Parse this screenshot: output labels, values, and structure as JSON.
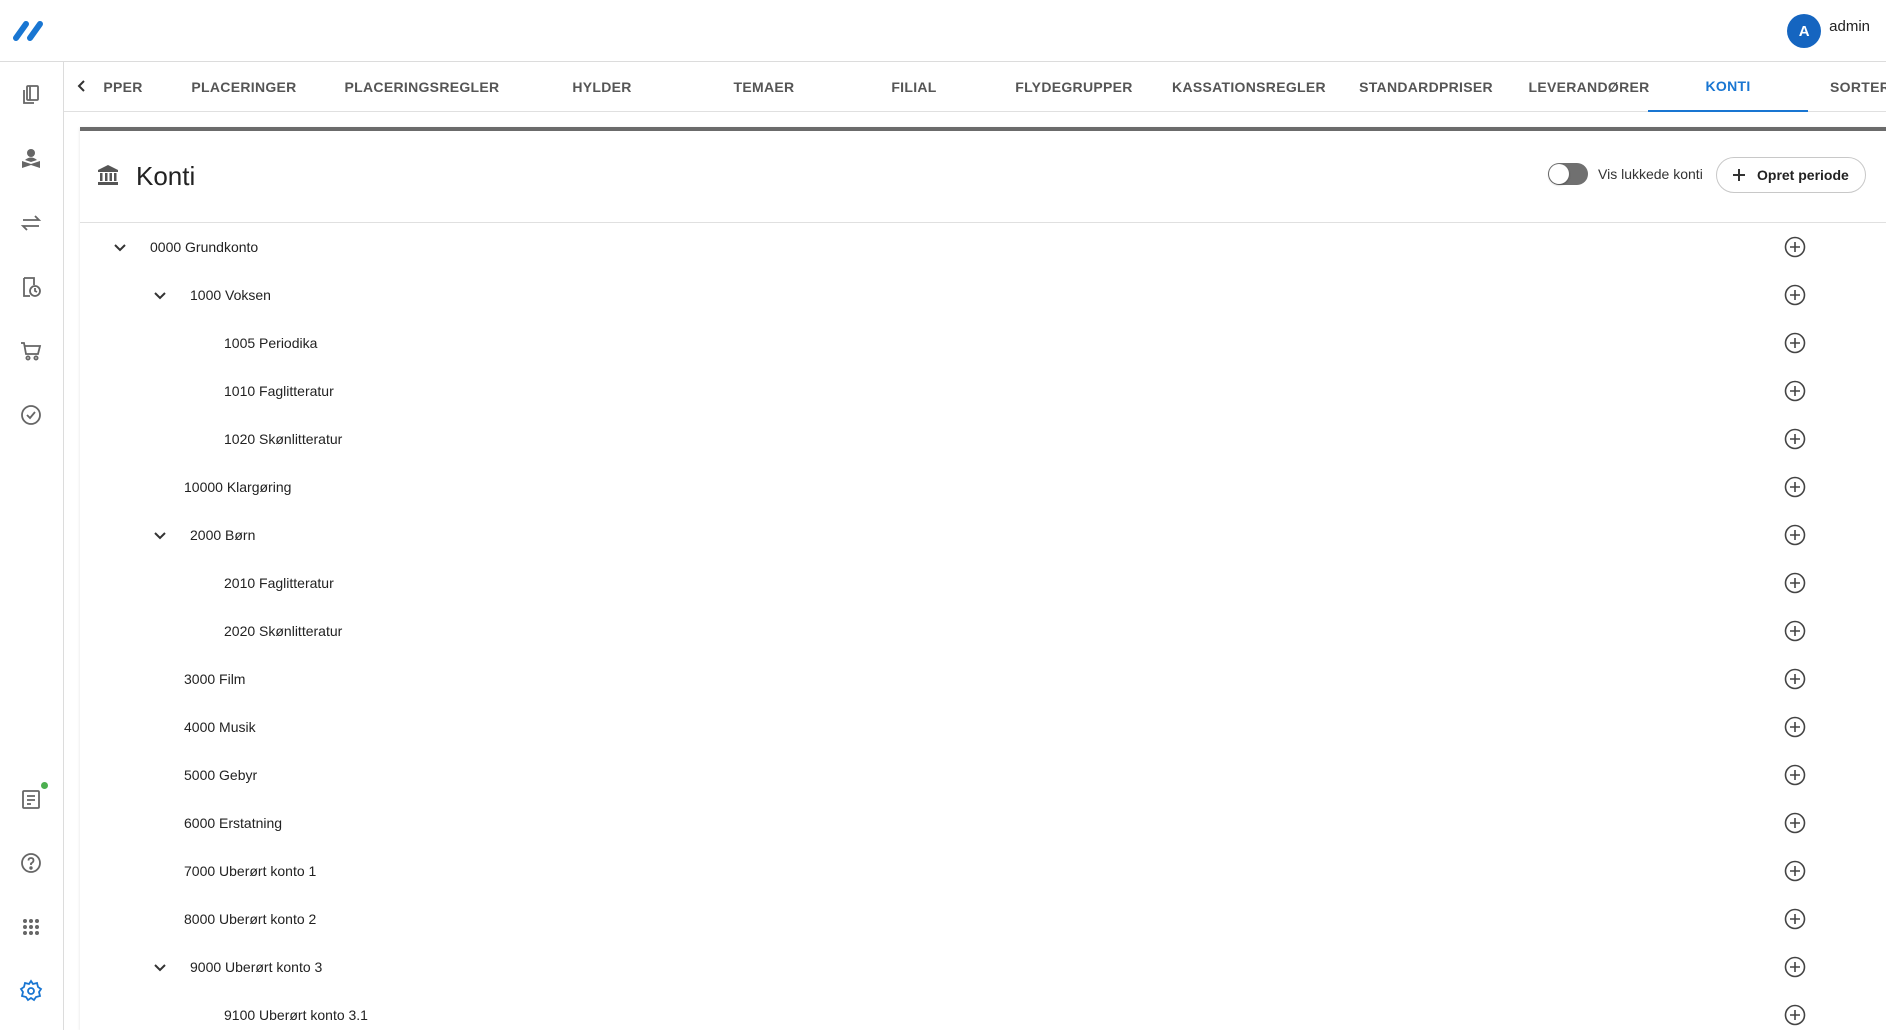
{
  "user": {
    "initial": "A",
    "name": "admin"
  },
  "tabs": [
    {
      "label": "PPER",
      "active": false
    },
    {
      "label": "PLACERINGER",
      "active": false
    },
    {
      "label": "PLACERINGSREGLER",
      "active": false
    },
    {
      "label": "HYLDER",
      "active": false
    },
    {
      "label": "TEMAER",
      "active": false
    },
    {
      "label": "FILIAL",
      "active": false
    },
    {
      "label": "FLYDEGRUPPER",
      "active": false
    },
    {
      "label": "KASSATIONSREGLER",
      "active": false
    },
    {
      "label": "STANDARDPRISER",
      "active": false
    },
    {
      "label": "LEVERANDØRER",
      "active": false
    },
    {
      "label": "KONTI",
      "active": true
    },
    {
      "label": "SORTER",
      "active": false
    }
  ],
  "sidebar": {
    "icons": [
      "copy-icon",
      "reader-icon",
      "swap-icon",
      "history-icon",
      "cart-icon",
      "check-circle-icon",
      "report-icon",
      "help-icon",
      "apps-icon",
      "settings-icon"
    ]
  },
  "page": {
    "title": "Konti",
    "toggle_label": "Vis lukkede konti",
    "toggle_on": false,
    "create_button": "Opret periode"
  },
  "tree": [
    {
      "label": "0000 Grundkonto",
      "level": 0,
      "expandable": true,
      "expanded": true
    },
    {
      "label": "1000 Voksen",
      "level": 1,
      "expandable": true,
      "expanded": true
    },
    {
      "label": "1005 Periodika",
      "level": 2,
      "expandable": false
    },
    {
      "label": "1010 Faglitteratur",
      "level": 2,
      "expandable": false
    },
    {
      "label": "1020 Skønlitteratur",
      "level": 2,
      "expandable": false
    },
    {
      "label": "10000 Klargøring",
      "level": 1,
      "expandable": false
    },
    {
      "label": "2000 Børn",
      "level": 1,
      "expandable": true,
      "expanded": true
    },
    {
      "label": "2010 Faglitteratur",
      "level": 2,
      "expandable": false
    },
    {
      "label": "2020 Skønlitteratur",
      "level": 2,
      "expandable": false
    },
    {
      "label": "3000 Film",
      "level": 1,
      "expandable": false
    },
    {
      "label": "4000 Musik",
      "level": 1,
      "expandable": false
    },
    {
      "label": "5000 Gebyr",
      "level": 1,
      "expandable": false
    },
    {
      "label": "6000 Erstatning",
      "level": 1,
      "expandable": false
    },
    {
      "label": "7000 Uberørt konto 1",
      "level": 1,
      "expandable": false
    },
    {
      "label": "8000 Uberørt konto 2",
      "level": 1,
      "expandable": false
    },
    {
      "label": "9000 Uberørt konto 3",
      "level": 1,
      "expandable": true,
      "expanded": true
    },
    {
      "label": "9100 Uberørt konto 3.1",
      "level": 2,
      "expandable": false
    }
  ],
  "colors": {
    "accent": "#1976d2",
    "avatar": "#1565c0",
    "notification": "#4caf50"
  }
}
